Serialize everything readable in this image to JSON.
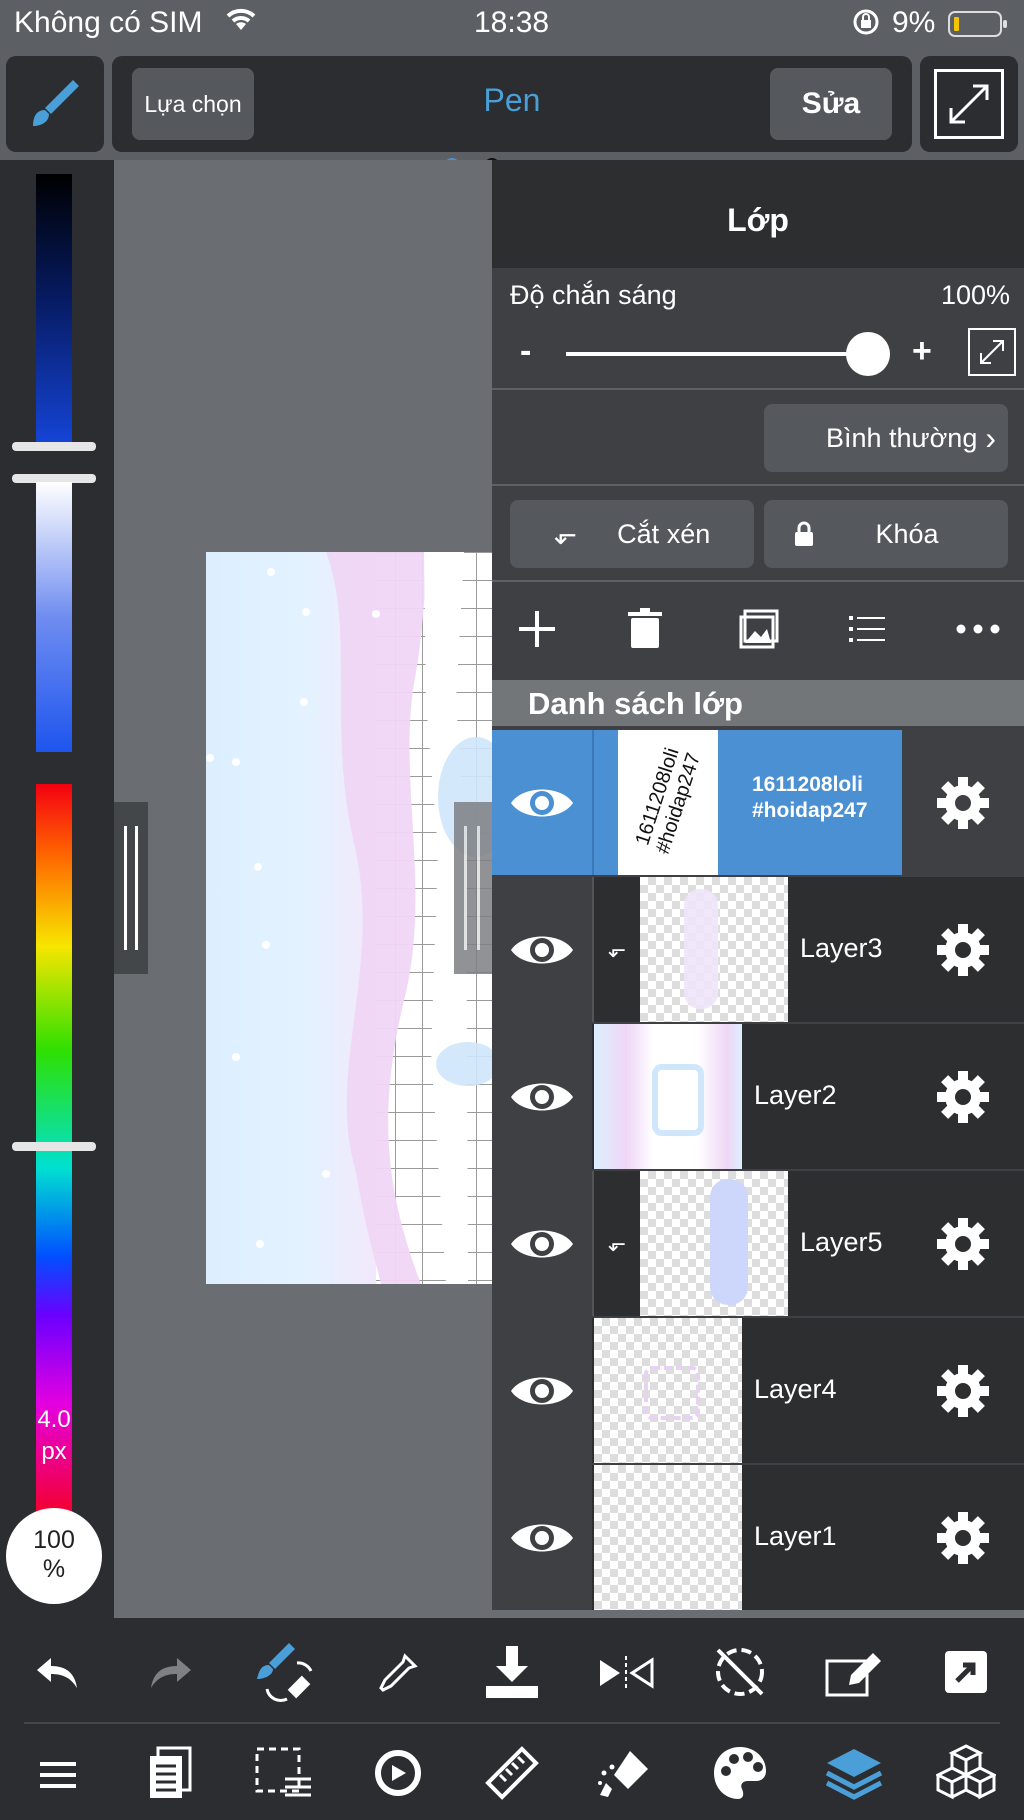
{
  "status_bar": {
    "carrier": "Không có SIM",
    "time": "18:38",
    "battery": "9%"
  },
  "toolbar": {
    "left_button": "Lựa chọn",
    "tool_name": "Pen",
    "edit_button": "Sửa"
  },
  "brush": {
    "size_value": "4.0",
    "size_unit": "px",
    "opacity": "100",
    "opacity_unit": "%"
  },
  "panel": {
    "title": "Lớp",
    "opacity_label": "Độ chắn sáng",
    "opacity_value": "100%",
    "opacity_fraction": 1.0,
    "minus": "-",
    "plus": "+",
    "blend_mode": "Bình thường",
    "clip_button": "Cắt xén",
    "lock_button": "Khóa",
    "list_header": "Danh sách lớp"
  },
  "layers": [
    {
      "name": "1611208loli\n#hoidap247",
      "thumb_text": "1611208loli #hoidap247",
      "selected": true,
      "clipped": false
    },
    {
      "name": "Layer3",
      "selected": false,
      "clipped": true
    },
    {
      "name": "Layer2",
      "selected": false,
      "clipped": false
    },
    {
      "name": "Layer5",
      "selected": false,
      "clipped": true
    },
    {
      "name": "Layer4",
      "selected": false,
      "clipped": false
    },
    {
      "name": "Layer1",
      "selected": false,
      "clipped": false
    }
  ],
  "colors": {
    "accent": "#4a90d2",
    "panel": "#3e4043",
    "dark": "#2b2d30"
  },
  "icons": {
    "bottom_row1": [
      "undo-icon",
      "redo-icon",
      "brush-swap-icon",
      "eyedropper-icon",
      "download-icon",
      "flip-icon",
      "rotate-off-icon",
      "edit-canvas-icon",
      "export-icon"
    ],
    "bottom_row2": [
      "menu-icon",
      "pages-icon",
      "selection-icon",
      "transform-icon",
      "ruler-icon",
      "fill-icon",
      "palette-icon",
      "layers-icon",
      "materials-icon"
    ]
  }
}
